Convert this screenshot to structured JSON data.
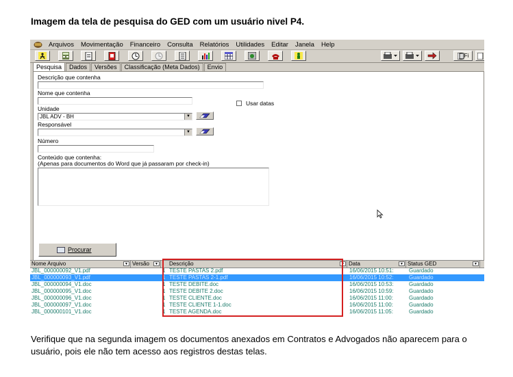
{
  "doc": {
    "title": "Imagem da tela de pesquisa do GED com um usuário nivel P4.",
    "note": "Verifique que na segunda imagem os documentos anexados em Contratos e Advogados não aparecem para o usuário, pois ele não tem acesso aos registros destas telas."
  },
  "menu": [
    "Arquivos",
    "Movimentação",
    "Financeiro",
    "Consulta",
    "Relatórios",
    "Utilidades",
    "Editar",
    "Janela",
    "Help"
  ],
  "toolbar": {
    "left_icons": [
      "exit-icon",
      "calculator-icon",
      "document-icon",
      "red-document-icon",
      "clock-icon",
      "gray-clock-icon",
      "document-list-icon",
      "bar-chart-icon",
      "calendar-icon",
      "settings-screen-icon",
      "phone-icon",
      "person-icon"
    ],
    "right_label": "Fi"
  },
  "tabs": [
    "Pesquisa",
    "Dados",
    "Versões",
    "Classificação (Meta Dados)",
    "Envio"
  ],
  "form": {
    "descricao_label": "Descrição que contenha",
    "descricao_value": "",
    "nome_label": "Nome que contenha",
    "nome_value": "",
    "usar_datas_label": "Usar datas",
    "unidade_label": "Unidade",
    "unidade_value": "JBL ADV - BH",
    "responsavel_label": "Responsável",
    "responsavel_value": "",
    "numero_label": "Número",
    "numero_value": "",
    "conteudo_label": "Conteúdo que contenha:",
    "conteudo_hint": "(Apenas para documentos do Word que já passaram por check-in)",
    "procurar_label": "Procurar"
  },
  "grid": {
    "columns": [
      "Nome Arquivo",
      "Versão",
      "Descrição",
      "Data",
      "Status GED"
    ],
    "rows": [
      {
        "nome": "JBL_000000092_V1.pdf",
        "versao": "1",
        "descricao": "TESTE PASTAS 2.pdf",
        "data": "16/06/2015 10:51:",
        "status": "Guardado",
        "selected": false
      },
      {
        "nome": "JBL_000000093_V1.pdf",
        "versao": "1",
        "descricao": "TESTE PASTAS 2-1.pdf",
        "data": "16/06/2015 10:52:",
        "status": "Guardado",
        "selected": true
      },
      {
        "nome": "JBL_000000094_V1.doc",
        "versao": "1",
        "descricao": "TESTE DEBITE.doc",
        "data": "16/06/2015 10:53:",
        "status": "Guardado",
        "selected": false
      },
      {
        "nome": "JBL_000000095_V1.doc",
        "versao": "1",
        "descricao": "TESTE DEBITE 2.doc",
        "data": "16/06/2015 10:59:",
        "status": "Guardado",
        "selected": false
      },
      {
        "nome": "JBL_000000096_V1.doc",
        "versao": "1",
        "descricao": "TESTE CLIENTE.doc",
        "data": "16/06/2015 11:00:",
        "status": "Guardado",
        "selected": false
      },
      {
        "nome": "JBL_000000097_V1.doc",
        "versao": "1",
        "descricao": "TESTE CLIENTE 1-1.doc",
        "data": "16/06/2015 11:00:",
        "status": "Guardado",
        "selected": false
      },
      {
        "nome": "JBL_000000101_V1.doc",
        "versao": "1",
        "descricao": "TESTE AGENDA.doc",
        "data": "16/06/2015 11:05:",
        "status": "Guardado",
        "selected": false
      }
    ]
  },
  "colors": {
    "highlight_box": "#d42020",
    "selection": "#3399ff",
    "row_text": "#1a7a6a"
  }
}
